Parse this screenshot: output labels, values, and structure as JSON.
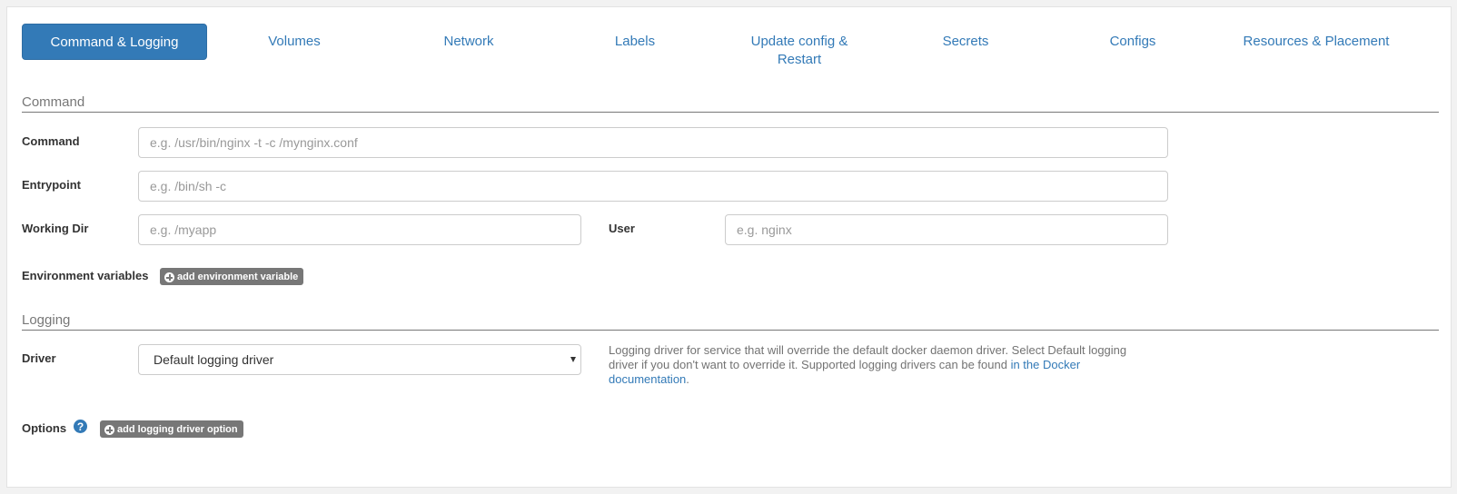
{
  "tabs": [
    {
      "label": "Command & Logging",
      "active": true
    },
    {
      "label": "Volumes"
    },
    {
      "label": "Network"
    },
    {
      "label": "Labels"
    },
    {
      "label": "Update config & Restart"
    },
    {
      "label": "Secrets"
    },
    {
      "label": "Configs"
    },
    {
      "label": "Resources & Placement"
    }
  ],
  "command_section": {
    "title": "Command",
    "command": {
      "label": "Command",
      "placeholder": "e.g. /usr/bin/nginx -t -c /mynginx.conf",
      "value": ""
    },
    "entrypoint": {
      "label": "Entrypoint",
      "placeholder": "e.g. /bin/sh -c",
      "value": ""
    },
    "working_dir": {
      "label": "Working Dir",
      "placeholder": "e.g. /myapp",
      "value": ""
    },
    "user": {
      "label": "User",
      "placeholder": "e.g. nginx",
      "value": ""
    },
    "env": {
      "label": "Environment variables",
      "button": "add environment variable"
    }
  },
  "logging_section": {
    "title": "Logging",
    "driver": {
      "label": "Driver",
      "selected": "Default logging driver"
    },
    "help": {
      "text": "Logging driver for service that will override the default docker daemon driver. Select Default logging driver if you don't want to override it. Supported logging drivers can be found ",
      "link": "in the Docker documentation",
      "end": "."
    },
    "options": {
      "label": "Options",
      "help_icon": "?",
      "button": "add logging driver option"
    }
  },
  "colors": {
    "accent": "#337ab7",
    "badge": "#777777"
  }
}
